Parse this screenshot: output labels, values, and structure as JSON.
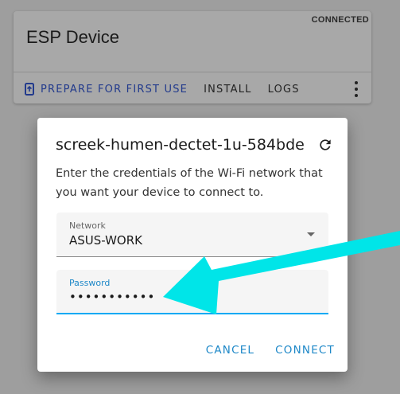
{
  "card": {
    "title": "ESP Device",
    "status": "CONNECTED",
    "actions": {
      "prepare": "PREPARE FOR FIRST USE",
      "install": "INSTALL",
      "logs": "LOGS"
    }
  },
  "dialog": {
    "title": "screek-humen-dectet-1u-584bde",
    "description": "Enter the credentials of the Wi-Fi network that you want your device to connect to.",
    "network": {
      "label": "Network",
      "value": "ASUS-WORK"
    },
    "password": {
      "label": "Password",
      "value": "•••••••••••"
    },
    "buttons": {
      "cancel": "CANCEL",
      "connect": "CONNECT"
    }
  },
  "colors": {
    "accent": "#03a9f4",
    "primary_action": "#223a8c",
    "annotation_arrow": "#00e5e8"
  }
}
